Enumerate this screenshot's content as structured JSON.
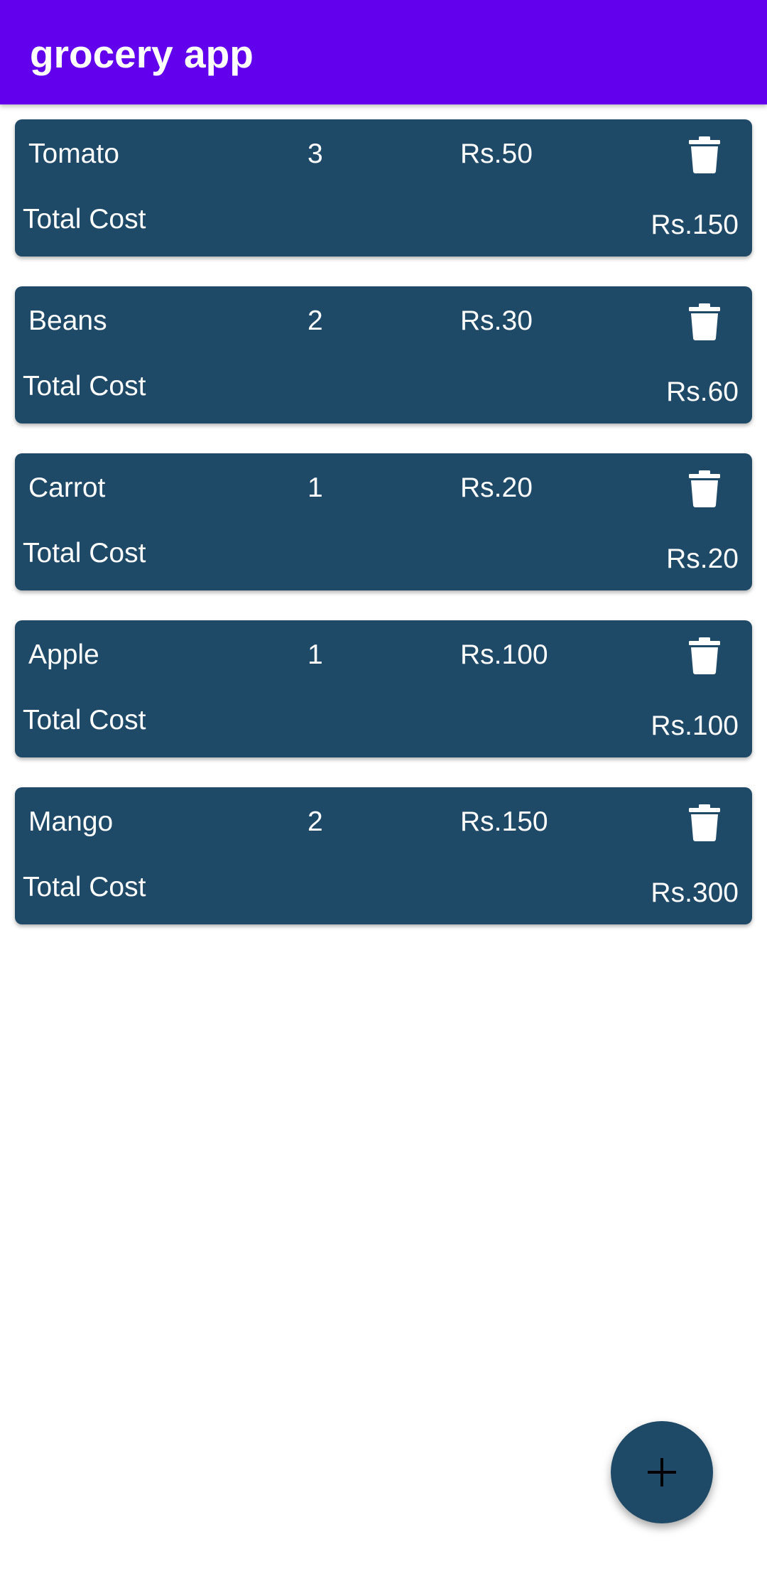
{
  "app_bar": {
    "title": "grocery app",
    "color": "#6200EE"
  },
  "card_color": "#1F4A67",
  "items": [
    {
      "name": "Tomato",
      "quantity": "3",
      "price": "Rs.50",
      "total_label": "Total Cost",
      "total": "Rs.150",
      "delete_icon": "trash-icon"
    },
    {
      "name": "Beans",
      "quantity": "2",
      "price": "Rs.30",
      "total_label": "Total Cost",
      "total": "Rs.60",
      "delete_icon": "trash-icon"
    },
    {
      "name": "Carrot",
      "quantity": "1",
      "price": "Rs.20",
      "total_label": "Total Cost",
      "total": "Rs.20",
      "delete_icon": "trash-icon"
    },
    {
      "name": "Apple",
      "quantity": "1",
      "price": "Rs.100",
      "total_label": "Total Cost",
      "total": "Rs.100",
      "delete_icon": "trash-icon"
    },
    {
      "name": "Mango",
      "quantity": "2",
      "price": "Rs.150",
      "total_label": "Total Cost",
      "total": "Rs.300",
      "delete_icon": "trash-icon"
    }
  ],
  "fab": {
    "icon": "plus-icon"
  }
}
